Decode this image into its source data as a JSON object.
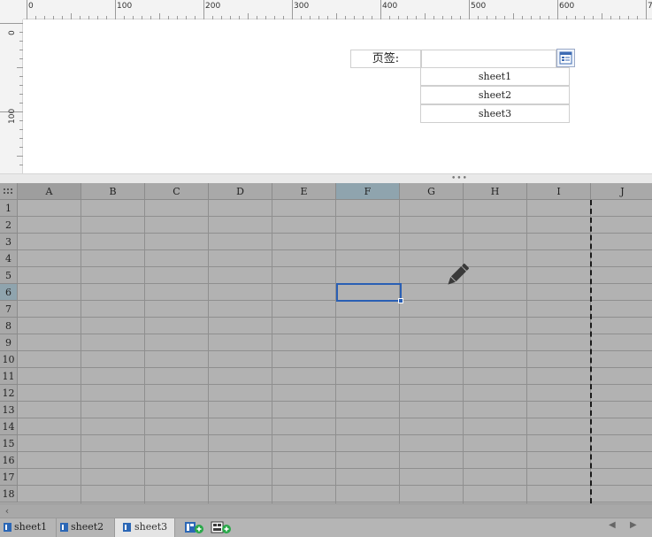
{
  "ruler": {
    "h_labels": [
      "0",
      "100",
      "200",
      "300",
      "400",
      "500",
      "600",
      "70"
    ],
    "v_labels": [
      "0",
      "100"
    ]
  },
  "form": {
    "page_label": "页签:",
    "page_input_value": "",
    "sheet_buttons": [
      "sheet1",
      "sheet2",
      "sheet3"
    ]
  },
  "grid": {
    "columns": [
      "A",
      "B",
      "C",
      "D",
      "E",
      "F",
      "G",
      "H",
      "I",
      "J"
    ],
    "rows": [
      "1",
      "2",
      "3",
      "4",
      "5",
      "6",
      "7",
      "8",
      "9",
      "10",
      "11",
      "12",
      "13",
      "14",
      "15",
      "16",
      "17",
      "18"
    ],
    "selected_column": "F",
    "selected_row": "6"
  },
  "tabs": {
    "sheets": [
      "sheet1",
      "sheet2",
      "sheet3"
    ],
    "active": "sheet3"
  },
  "icons": {
    "picker": "table-picker-icon",
    "cursor": "pencil-icon",
    "add_sheet": "add-report-sheet-icon",
    "add_dashboard": "add-dashboard-sheet-icon"
  },
  "colors": {
    "selection": "#2a5fb4",
    "grid_bg": "#b2b2b2",
    "header_selected": "#8fa4ae"
  }
}
